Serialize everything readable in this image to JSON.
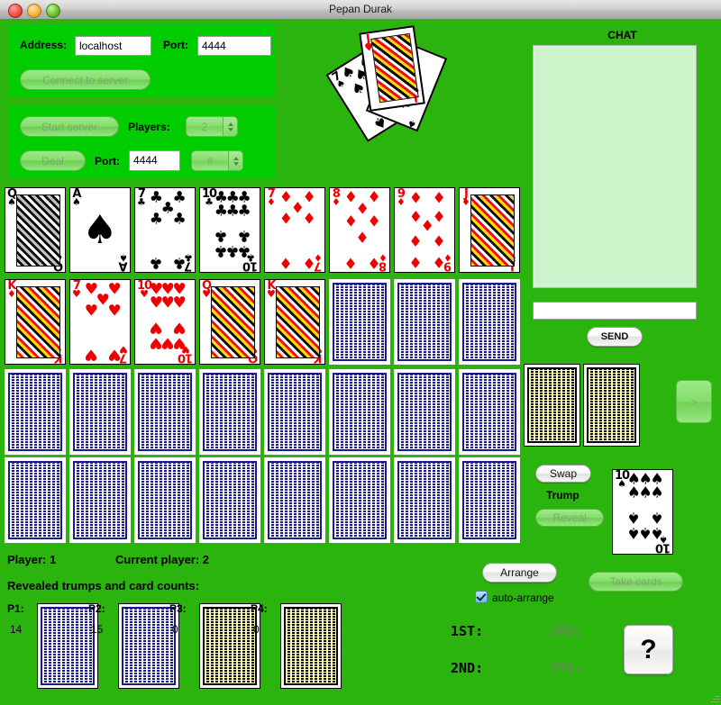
{
  "window": {
    "title": "Pepan Durak",
    "traffic_lights": [
      "close",
      "minimize",
      "maximize"
    ]
  },
  "colors": {
    "background_green": "#2cb40e",
    "panel_green": "#00cc00",
    "chat_bg": "#ccf5cc",
    "card_back_blue": "#1a1a8c",
    "card_back_yellow": "#ffffb4",
    "suit_red": "#ee0000",
    "suit_black": "#000000"
  },
  "connect_panel": {
    "address_label": "Address:",
    "address_value": "localhost",
    "address_placeholder": "localhost",
    "port_label": "Port:",
    "port_value": "4444",
    "port_placeholder": "4444",
    "connect_button": "Connect to server",
    "connect_enabled": false
  },
  "server_panel": {
    "start_button": "Start server",
    "start_enabled": false,
    "players_label": "Players:",
    "players_value": "2",
    "players_enabled": false,
    "deal_button": "Deal",
    "deal_enabled": false,
    "port_label": "Port:",
    "port_value": "4444",
    "hash_value": "#",
    "hash_enabled": false
  },
  "chat": {
    "title": "CHAT",
    "messages": "",
    "input_value": "",
    "input_placeholder": "",
    "send_button": "SEND"
  },
  "table_fan": [
    {
      "rank": "7",
      "suit": "spades",
      "color": "black",
      "rotate": -32
    },
    {
      "rank": "",
      "suit": "spades",
      "color": "black",
      "rotate": 22
    },
    {
      "rank": "J",
      "suit": "hearts",
      "color": "red",
      "rotate": -8
    }
  ],
  "hand_row_1": [
    {
      "rank": "Q",
      "suit": "spades",
      "symbol": "♠",
      "color": "black",
      "court": true
    },
    {
      "rank": "A",
      "suit": "spades",
      "symbol": "♠",
      "color": "black",
      "court": false
    },
    {
      "rank": "7",
      "suit": "clubs",
      "symbol": "♣",
      "color": "black",
      "court": false
    },
    {
      "rank": "10",
      "suit": "clubs",
      "symbol": "♣",
      "color": "black",
      "court": false
    },
    {
      "rank": "7",
      "suit": "diamonds",
      "symbol": "♦",
      "color": "red",
      "court": false
    },
    {
      "rank": "8",
      "suit": "diamonds",
      "symbol": "♦",
      "color": "red",
      "court": false
    },
    {
      "rank": "9",
      "suit": "diamonds",
      "symbol": "♦",
      "color": "red",
      "court": false
    },
    {
      "rank": "J",
      "suit": "diamonds",
      "symbol": "♦",
      "color": "red",
      "court": true
    }
  ],
  "hand_row_2": [
    {
      "rank": "K",
      "suit": "diamonds",
      "symbol": "♦",
      "color": "red",
      "court": true,
      "facedown": false
    },
    {
      "rank": "7",
      "suit": "hearts",
      "symbol": "♥",
      "color": "red",
      "court": false,
      "facedown": false
    },
    {
      "rank": "10",
      "suit": "hearts",
      "symbol": "♥",
      "color": "red",
      "court": false,
      "facedown": false
    },
    {
      "rank": "Q",
      "suit": "hearts",
      "symbol": "♥",
      "color": "red",
      "court": true,
      "facedown": false
    },
    {
      "rank": "K",
      "suit": "hearts",
      "symbol": "♥",
      "color": "red",
      "court": true,
      "facedown": false
    },
    {
      "facedown": true
    },
    {
      "facedown": true
    },
    {
      "facedown": true
    }
  ],
  "play_row_3": [
    {
      "facedown": true
    },
    {
      "facedown": true
    },
    {
      "facedown": true
    },
    {
      "facedown": true
    },
    {
      "facedown": true
    },
    {
      "facedown": true
    },
    {
      "facedown": true
    },
    {
      "facedown": true
    }
  ],
  "play_row_4": [
    {
      "facedown": true
    },
    {
      "facedown": true
    },
    {
      "facedown": true
    },
    {
      "facedown": true
    },
    {
      "facedown": true
    },
    {
      "facedown": true
    },
    {
      "facedown": true
    },
    {
      "facedown": true
    }
  ],
  "deck": {
    "cards": [
      {
        "back": "yellow"
      },
      {
        "back": "yellow"
      }
    ],
    "next_button": ">",
    "next_enabled": false
  },
  "trump_controls": {
    "swap_button": "Swap",
    "swap_enabled": true,
    "trump_label": "Trump",
    "reveal_button": "Reveal",
    "reveal_enabled": false,
    "trump_card": {
      "rank": "10",
      "suit": "spades",
      "symbol": "♠",
      "color": "black"
    }
  },
  "status": {
    "player_label": "Player: 1",
    "current_player_label": "Current player: 2",
    "revealed_label": "Revealed trumps and card counts:"
  },
  "players": [
    {
      "name": "P1:",
      "count": "14",
      "back": "blue"
    },
    {
      "name": "P2:",
      "count": "15",
      "back": "blue"
    },
    {
      "name": "P3:",
      "count": "0",
      "back": "yellow"
    },
    {
      "name": "P4:",
      "count": "0",
      "back": "yellow"
    }
  ],
  "actions": {
    "arrange_button": "Arrange",
    "arrange_enabled": true,
    "auto_arrange_label": "auto-arrange",
    "auto_arrange_checked": true,
    "take_cards_button": "Take cards",
    "take_cards_enabled": false,
    "help_button": "?"
  },
  "placements": [
    {
      "label": "1ST:",
      "value": "",
      "active": true
    },
    {
      "label": "2ND:",
      "value": "",
      "active": true
    },
    {
      "label": "3RD:",
      "value": "",
      "active": false
    },
    {
      "label": "4TH:",
      "value": "",
      "active": false
    }
  ]
}
